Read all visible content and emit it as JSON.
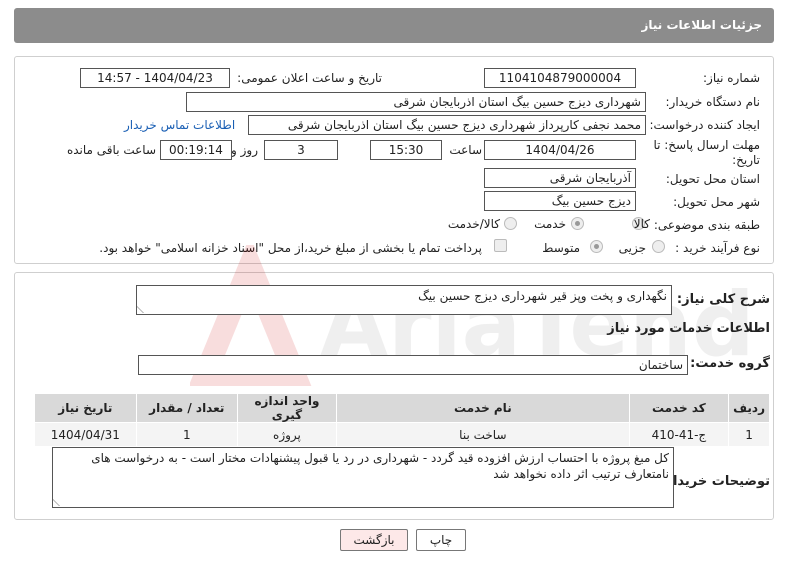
{
  "header": {
    "title": "جزئیات اطلاعات نیاز"
  },
  "fields": {
    "need_number_label": "شماره نیاز:",
    "need_number": "1104104879000004",
    "announce_label": "تاریخ و ساعت اعلان عمومی:",
    "announce_value": "1404/04/23 - 14:57",
    "buyer_org_label": "نام دستگاه خریدار:",
    "buyer_org": "شهرداری دیزج حسین بیگ استان اذربایجان شرقی",
    "creator_label": "ایجاد کننده درخواست:",
    "creator": "محمد نجفی کارپرداز شهرداری دیزج حسین بیگ استان اذربایجان شرقی",
    "contact_link": "اطلاعات تماس خریدار",
    "deadline_label": "مهلت ارسال پاسخ: تا تاریخ:",
    "deadline_date": "1404/04/26",
    "time_label": "ساعت",
    "deadline_time": "15:30",
    "days_value": "3",
    "days_label": "روز و",
    "remaining_value": "00:19:14",
    "remaining_label": "ساعت باقی مانده",
    "province_label": "استان محل تحویل:",
    "province": "آذربایجان شرقی",
    "city_label": "شهر محل تحویل:",
    "city": "دیزج حسین بیگ",
    "category_label": "طبقه بندی موضوعی:",
    "category_options": [
      "کالا",
      "خدمت",
      "کالا/خدمت"
    ],
    "process_label": "نوع فرآیند خرید :",
    "process_options": [
      "جزیی",
      "متوسط"
    ],
    "payment_note": "پرداخت تمام یا بخشی از مبلغ خرید،از محل \"اسناد خزانه اسلامی\" خواهد بود."
  },
  "summary": {
    "label": "شرح کلی نیاز:",
    "value": "نگهداری و پخت وپز قیر شهرداری دیزج حسین بیگ"
  },
  "services": {
    "section_title": "اطلاعات خدمات مورد نیاز",
    "group_label": "گروه خدمت:",
    "group_value": "ساختمان",
    "columns": [
      "ردیف",
      "کد خدمت",
      "نام خدمت",
      "واحد اندازه گیری",
      "تعداد / مقدار",
      "تاریخ نیاز"
    ],
    "rows": [
      [
        "1",
        "ج-41-410",
        "ساخت بنا",
        "پروژه",
        "1",
        "1404/04/31"
      ]
    ]
  },
  "notes": {
    "label": "توضیحات خریدار:",
    "value": "کل مبغ پروژه با احتساب ارزش افزوده قید گردد - شهرداری در رد یا قبول پیشنهادات مختار است - به درخواست های نامتعارف ترتیب اثر داده نخواهد شد"
  },
  "buttons": {
    "print": "چاپ",
    "back": "بازگشت"
  },
  "watermark": {
    "text": "AriaTender.neT"
  },
  "colors": {
    "header_bg": "#8c8c8c",
    "back_button_bg": "#fde8e8",
    "link": "#1a5fb4"
  }
}
